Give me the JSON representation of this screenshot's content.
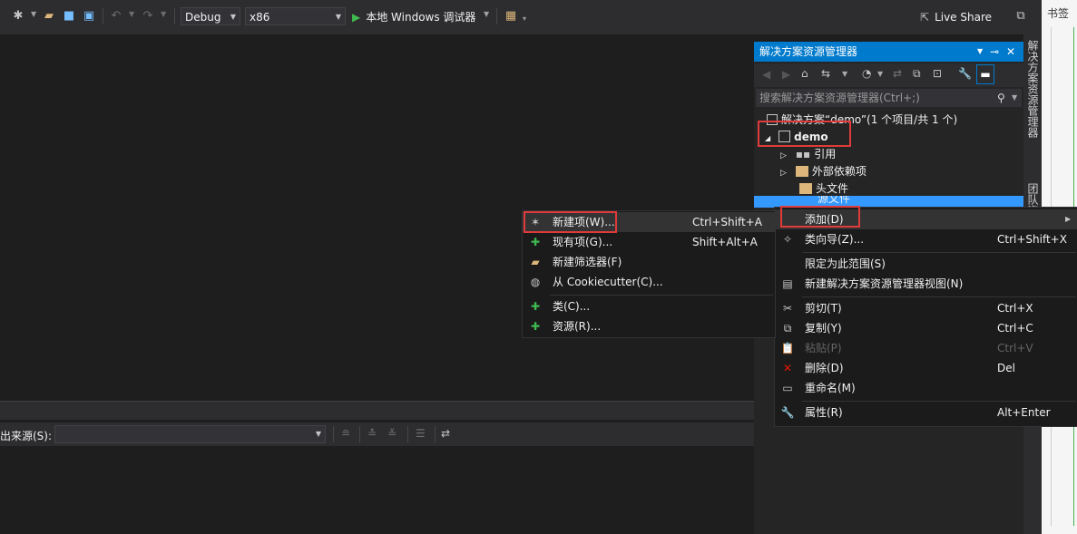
{
  "toolbar": {
    "config": "Debug",
    "platform": "x86",
    "run_label": "本地 Windows 调试器",
    "live_share": "Live Share"
  },
  "right_strip": {
    "bookmark_tab": "书签",
    "solution_explorer_tab": "解决方案资源管理器",
    "team_explorer_tab": "团队资源管理器"
  },
  "solution_explorer": {
    "title": "解决方案资源管理器",
    "search_placeholder": "搜索解决方案资源管理器(Ctrl+;)",
    "solution_label": "解决方案“demo”(1 个项目/共 1 个)",
    "project": "demo",
    "items": [
      {
        "label": "引用"
      },
      {
        "label": "外部依赖项"
      },
      {
        "label": "头文件"
      },
      {
        "label": "源文件"
      }
    ]
  },
  "context_menu": {
    "items": [
      {
        "label": "添加(D)",
        "shortcut": ""
      },
      {
        "label": "类向导(Z)...",
        "shortcut": "Ctrl+Shift+X"
      },
      {
        "label": "限定为此范围(S)",
        "shortcut": ""
      },
      {
        "label": "新建解决方案资源管理器视图(N)",
        "shortcut": ""
      },
      {
        "label": "剪切(T)",
        "shortcut": "Ctrl+X"
      },
      {
        "label": "复制(Y)",
        "shortcut": "Ctrl+C"
      },
      {
        "label": "粘贴(P)",
        "shortcut": "Ctrl+V"
      },
      {
        "label": "删除(D)",
        "shortcut": "Del"
      },
      {
        "label": "重命名(M)",
        "shortcut": ""
      },
      {
        "label": "属性(R)",
        "shortcut": "Alt+Enter"
      }
    ]
  },
  "add_submenu": {
    "items": [
      {
        "label": "新建项(W)...",
        "shortcut": "Ctrl+Shift+A"
      },
      {
        "label": "现有项(G)...",
        "shortcut": "Shift+Alt+A"
      },
      {
        "label": "新建筛选器(F)",
        "shortcut": ""
      },
      {
        "label": "从 Cookiecutter(C)...",
        "shortcut": ""
      },
      {
        "label": "类(C)...",
        "shortcut": ""
      },
      {
        "label": "资源(R)...",
        "shortcut": ""
      }
    ]
  },
  "output": {
    "source_label": "出来源(S):",
    "source_value": ""
  },
  "colors": {
    "accent": "#007acc",
    "highlight_box": "#e03a3a",
    "menu_bg": "#1b1b1c",
    "editor_bg": "#1e1e1e"
  }
}
